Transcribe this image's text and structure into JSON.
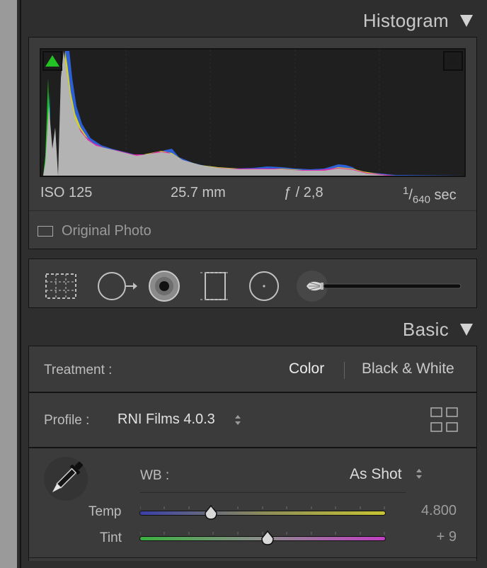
{
  "histogram": {
    "title": "Histogram",
    "exif": {
      "iso": "ISO 125",
      "focal": "25.7 mm",
      "aperture": "ƒ / 2,8",
      "shutter_num": "1",
      "shutter_den": "640",
      "shutter_unit": "sec"
    },
    "original_photo_label": "Original Photo",
    "clip_shadow_on": true,
    "clip_highlight_on": false
  },
  "tools": [
    "crop-overlay-tool",
    "spot-removal-tool",
    "red-eye-tool",
    "graduated-filter-tool",
    "radial-filter-tool",
    "adjustment-brush-tool"
  ],
  "basic": {
    "title": "Basic",
    "treatment": {
      "label": "Treatment :",
      "options": [
        "Color",
        "Black & White"
      ],
      "selected": "Color"
    },
    "profile": {
      "label": "Profile :",
      "value": "RNI Films 4.0.3"
    },
    "wb": {
      "label": "WB :",
      "value": "As Shot"
    },
    "temp": {
      "label": "Temp",
      "value": "4.800",
      "position": 0.29
    },
    "tint": {
      "label": "Tint",
      "value": "+ 9",
      "position": 0.52
    }
  },
  "colors": {
    "accent_green": "#22c322",
    "panel_bg": "#3b3b3b"
  }
}
